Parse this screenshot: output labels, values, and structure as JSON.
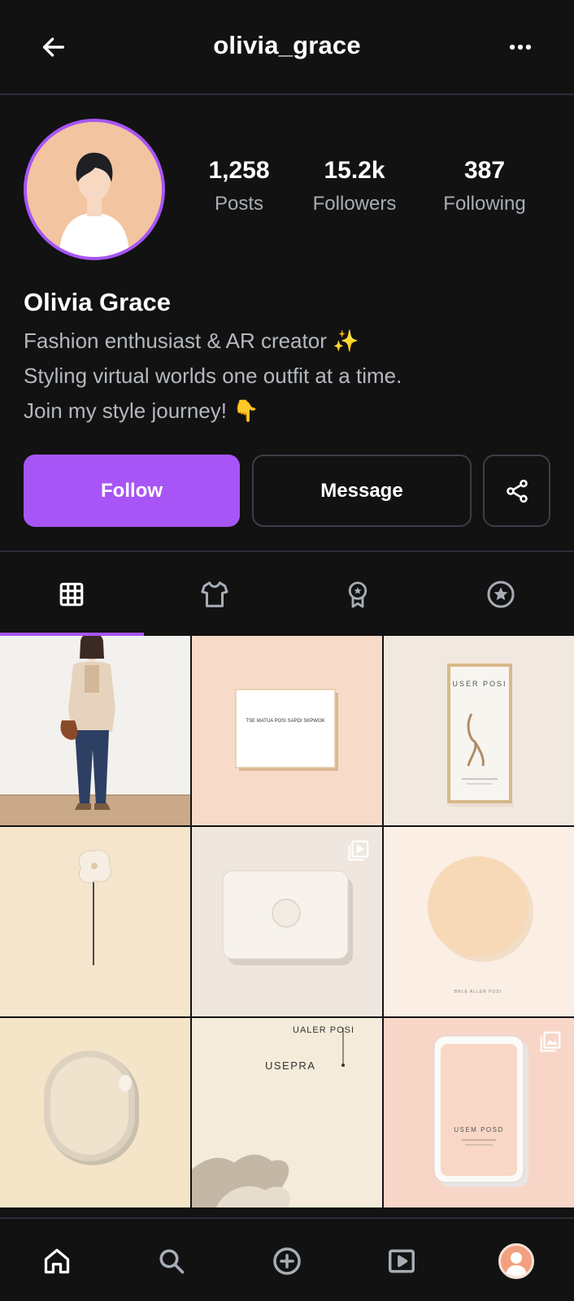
{
  "header": {
    "title": "olivia_grace",
    "back_icon": "arrow-left-icon",
    "more_icon": "more-horizontal-icon"
  },
  "profile": {
    "name": "Olivia Grace",
    "bio_lines": [
      "Fashion enthusiast & AR creator ✨",
      "Styling virtual worlds one outfit at a time.",
      "Join my style journey! 👇"
    ],
    "accent_color": "#a855f7",
    "stats": [
      {
        "value": "1,258",
        "label": "Posts"
      },
      {
        "value": "15.2k",
        "label": "Followers"
      },
      {
        "value": "387",
        "label": "Following"
      }
    ]
  },
  "actions": {
    "follow_label": "Follow",
    "message_label": "Message",
    "share_icon": "share-icon"
  },
  "tabs": [
    {
      "icon": "grid-icon",
      "active": true
    },
    {
      "icon": "shirt-icon",
      "active": false
    },
    {
      "icon": "award-icon",
      "active": false
    },
    {
      "icon": "star-icon",
      "active": false
    }
  ],
  "grid": {
    "tiles": [
      {
        "kind": "photo-outfit",
        "badge": ""
      },
      {
        "kind": "card",
        "text": "TSE MATUA POSI SAPDI SKPWOK",
        "badge": ""
      },
      {
        "kind": "poster",
        "text": "USER POSI",
        "badge": ""
      },
      {
        "kind": "flower",
        "badge": ""
      },
      {
        "kind": "box",
        "badge": "reel-icon"
      },
      {
        "kind": "circle",
        "text": "BRLE ALLER POSI",
        "badge": ""
      },
      {
        "kind": "oval",
        "badge": ""
      },
      {
        "kind": "text-card",
        "text": "UALER POSI",
        "text2": "USEPRA",
        "badge": ""
      },
      {
        "kind": "phone",
        "text": "USEM POSD",
        "badge": "gallery-icon"
      }
    ]
  },
  "bottom_nav": [
    {
      "icon": "home-icon"
    },
    {
      "icon": "search-icon"
    },
    {
      "icon": "add-circle-icon"
    },
    {
      "icon": "video-icon"
    },
    {
      "icon": "profile-avatar"
    }
  ]
}
